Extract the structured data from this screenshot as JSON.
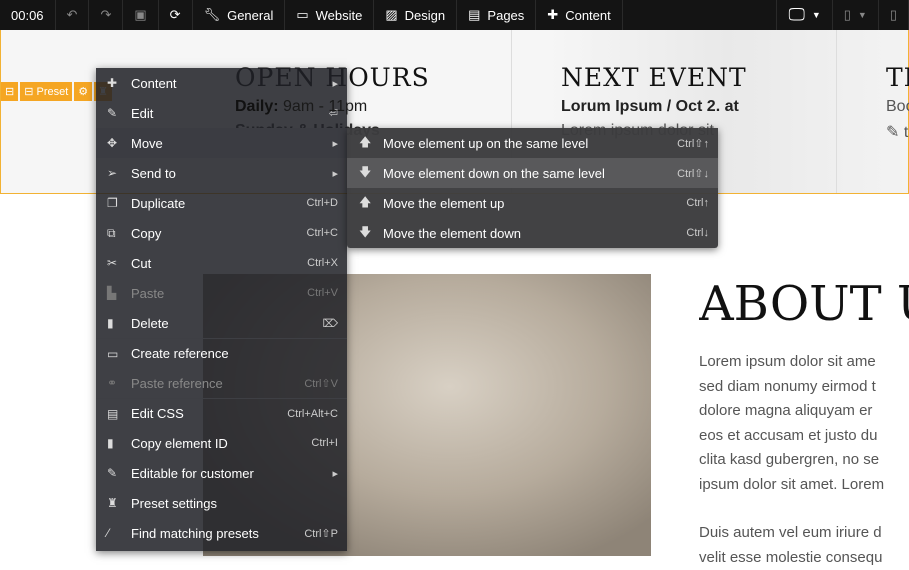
{
  "toolbar": {
    "time": "00:06",
    "items": [
      {
        "label": "General",
        "icon": "wrench-icon"
      },
      {
        "label": "Website",
        "icon": "monitor-icon"
      },
      {
        "label": "Design",
        "icon": "image-icon"
      },
      {
        "label": "Pages",
        "icon": "file-icon"
      },
      {
        "label": "Content",
        "icon": "plus-icon"
      }
    ]
  },
  "element_tools": {
    "preset_label": "Preset"
  },
  "columns": [
    {
      "title": "OPEN HOURS",
      "line1_bold": "Daily:",
      "line1": " 9am - 11pm",
      "line2": "Sunday & Holidays"
    },
    {
      "title": "NEXT EVENT",
      "line1_bold": "Lorum Ipsum / Oct 2. at",
      "line2": "Lorem ipsum dolor sit"
    },
    {
      "title": "TI",
      "line1": "Boo",
      "line2": "t"
    }
  ],
  "about": {
    "title": "ABOUT U",
    "paragraph1": [
      "Lorem ipsum dolor sit ame",
      "sed diam nonumy eirmod t",
      "dolore magna aliquyam er",
      "eos et accusam et justo du",
      "clita kasd gubergren, no se",
      "ipsum dolor sit amet. Lorem"
    ],
    "paragraph2": [
      "Duis autem vel eum iriure d",
      "velit esse molestie consequ"
    ]
  },
  "context_menu": [
    {
      "label": "Content",
      "icon": "plus-icon",
      "shortcut": "▸"
    },
    {
      "label": "Edit",
      "icon": "pencil-icon",
      "shortcut": "⏎"
    },
    {
      "label": "Move",
      "icon": "move-icon",
      "shortcut": "▸",
      "active": true
    },
    {
      "label": "Send to",
      "icon": "paper-plane-icon",
      "shortcut": "▸"
    },
    {
      "label": "Duplicate",
      "icon": "duplicate-icon",
      "shortcut": "Ctrl+D"
    },
    {
      "label": "Copy",
      "icon": "copy-icon",
      "shortcut": "Ctrl+C"
    },
    {
      "label": "Cut",
      "icon": "scissors-icon",
      "shortcut": "Ctrl+X"
    },
    {
      "label": "Paste",
      "icon": "paste-icon",
      "shortcut": "Ctrl+V",
      "disabled": true
    },
    {
      "label": "Delete",
      "icon": "trash-icon",
      "shortcut": "⌦"
    },
    {
      "label": "Create reference",
      "icon": "link-icon",
      "shortcut": "",
      "sep": true
    },
    {
      "label": "Paste reference",
      "icon": "chain-icon",
      "shortcut": "Ctrl⇧V",
      "disabled": true
    },
    {
      "label": "Edit CSS",
      "icon": "css-icon",
      "shortcut": "Ctrl+Alt+C",
      "sep": true
    },
    {
      "label": "Copy element ID",
      "icon": "document-icon",
      "shortcut": "Ctrl+I"
    },
    {
      "label": "Editable for customer",
      "icon": "edit-box-icon",
      "shortcut": "▸"
    },
    {
      "label": "Preset settings",
      "icon": "puzzle-icon",
      "shortcut": ""
    },
    {
      "label": "Find matching presets",
      "icon": "magic-wand-icon",
      "shortcut": "Ctrl⇧P"
    }
  ],
  "submenu": [
    {
      "label": "Move element up on the same level",
      "icon": "arrow-up-icon",
      "shortcut": "Ctrl⇧↑"
    },
    {
      "label": "Move element down on the same level",
      "icon": "arrow-down-icon",
      "shortcut": "Ctrl⇧↓",
      "active": true
    },
    {
      "label": "Move the element up",
      "icon": "arrow-up-icon",
      "shortcut": "Ctrl↑"
    },
    {
      "label": "Move the element down",
      "icon": "arrow-down-icon",
      "shortcut": "Ctrl↓"
    }
  ]
}
